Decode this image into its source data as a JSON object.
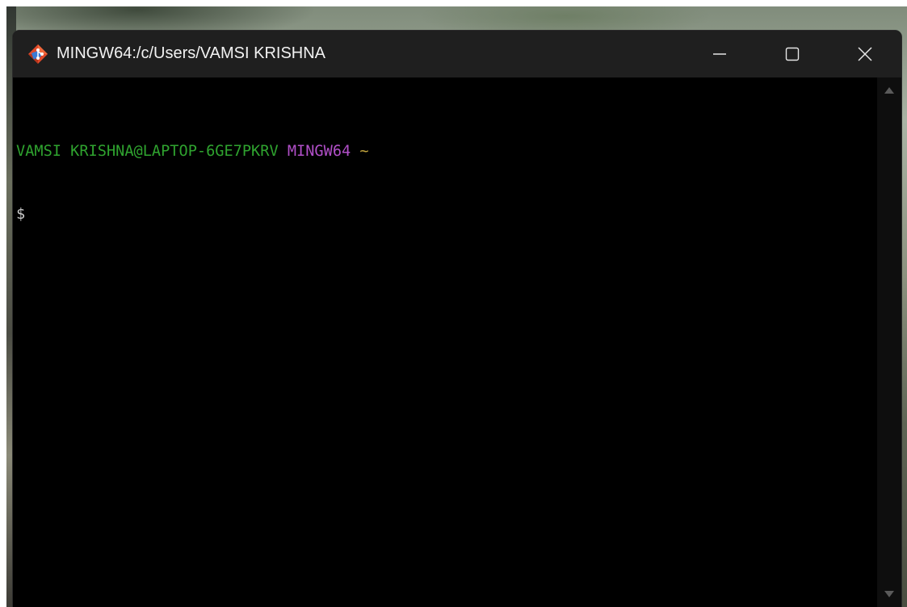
{
  "window": {
    "title": "MINGW64:/c/Users/VAMSI KRISHNA",
    "app_icon": "git-diamond-icon",
    "controls": {
      "minimize_icon": "minimize-icon",
      "maximize_icon": "maximize-icon",
      "close_icon": "close-icon"
    }
  },
  "terminal": {
    "lines": [
      {
        "user_host": "VAMSI KRISHNA@LAPTOP-6GE7PKRV",
        "shell": "MINGW64",
        "cwd": "~"
      }
    ],
    "prompt_symbol": "$"
  },
  "colors": {
    "user_host": "#2fa32f",
    "shell": "#b14fc8",
    "cwd": "#c0a23c",
    "background": "#000000",
    "titlebar": "#1f1f1f"
  },
  "scrollbar": {
    "up_icon": "scroll-up-arrow-icon",
    "down_icon": "scroll-down-arrow-icon"
  }
}
